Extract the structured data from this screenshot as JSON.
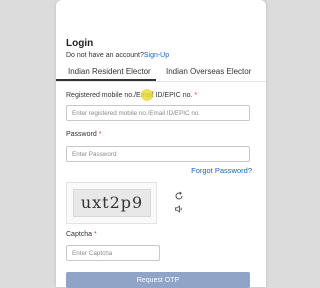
{
  "login": {
    "title": "Login",
    "no_account_text": "Do not have an account?",
    "signup_link": "Sign-Up"
  },
  "tabs": [
    {
      "label": "Indian Resident Elector",
      "active": true
    },
    {
      "label": "Indian Overseas Elector",
      "active": false
    }
  ],
  "fields": {
    "mobile": {
      "label": "Registered mobile no./Email ID/EPIC no.",
      "required_mark": "*",
      "placeholder": "Enter registered mobile no./Email ID/EPIC no."
    },
    "password": {
      "label": "Password",
      "required_mark": "*",
      "placeholder": "Enter Password"
    },
    "captcha": {
      "label": "Captcha",
      "required_mark": "*",
      "placeholder": "Enter Captcha"
    }
  },
  "forgot_password": "Forgot Password?",
  "captcha_text": "uxt2p9",
  "icons": {
    "refresh": "refresh-icon",
    "audio": "speaker-icon"
  },
  "request_button": "Request OTP",
  "colors": {
    "link": "#1565c0",
    "button": "#90a4c8",
    "required": "#e53935"
  }
}
